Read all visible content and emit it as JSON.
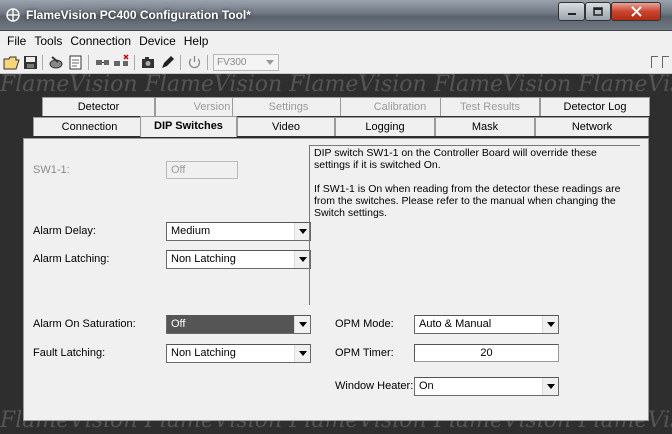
{
  "window": {
    "title": "FlameVision PC400 Configuration Tool*"
  },
  "menu": [
    "File",
    "Tools",
    "Connection",
    "Device",
    "Help"
  ],
  "toolbar": {
    "model_value": "FV300"
  },
  "background_watermark": "FlameVision  FlameVision  FlameVision  FlameVision  FlameVision",
  "tabs_row1": [
    {
      "label": "Detector",
      "enabled": true
    },
    {
      "label": "Version",
      "enabled": false
    },
    {
      "label": "Settings",
      "enabled": false
    },
    {
      "label": "Calibration",
      "enabled": false
    },
    {
      "label": "Test Results",
      "enabled": false
    },
    {
      "label": "Detector Log",
      "enabled": true
    }
  ],
  "tabs_row2": [
    {
      "label": "Connection"
    },
    {
      "label": "DIP Switches"
    },
    {
      "label": "Video"
    },
    {
      "label": "Logging"
    },
    {
      "label": "Mask"
    },
    {
      "label": "Network"
    }
  ],
  "active_tab": "DIP Switches",
  "form": {
    "sw11": {
      "label": "SW1-1:",
      "value": "Off"
    },
    "alarm_delay": {
      "label": "Alarm Delay:",
      "value": "Medium"
    },
    "alarm_latching": {
      "label": "Alarm Latching:",
      "value": "Non Latching"
    },
    "alarm_on_saturation": {
      "label": "Alarm On Saturation:",
      "value": "Off"
    },
    "fault_latching": {
      "label": "Fault Latching:",
      "value": "Non Latching"
    },
    "opm_mode": {
      "label": "OPM Mode:",
      "value": "Auto & Manual"
    },
    "opm_timer": {
      "label": "OPM Timer:",
      "value": "20"
    },
    "window_heater": {
      "label": "Window Heater:",
      "value": "On"
    }
  },
  "info": {
    "paragraph1": "DIP switch SW1-1 on the Controller Board will override these settings if it is switched On.",
    "paragraph2": "If SW1-1 is On when reading from the detector these readings are from the switches. Please refer to the manual when changing the Switch settings."
  },
  "colors": {
    "title_text": "#ffffff",
    "close_button": "#c8452f",
    "highlight_field": "#555555"
  }
}
